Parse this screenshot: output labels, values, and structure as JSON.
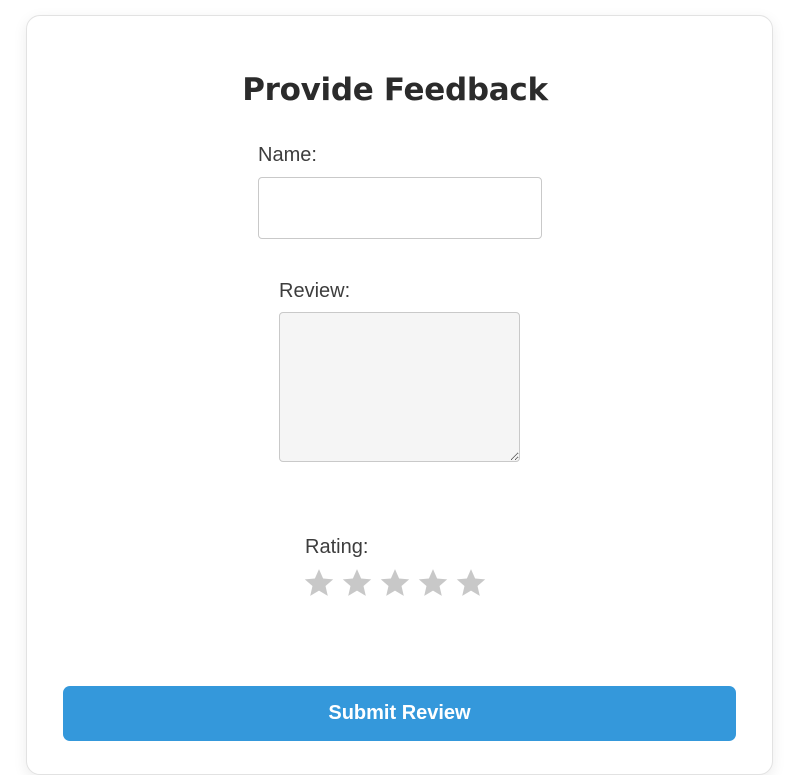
{
  "form": {
    "title": "Provide Feedback",
    "name_label": "Name:",
    "name_value": "",
    "review_label": "Review:",
    "review_value": "",
    "rating_label": "Rating:",
    "rating": {
      "max": 5,
      "selected": 0,
      "inactive_color": "#c8c8c8",
      "icon": "star-icon"
    },
    "submit_label": "Submit Review"
  },
  "colors": {
    "accent": "#3498db",
    "text": "#2b2b2b"
  }
}
